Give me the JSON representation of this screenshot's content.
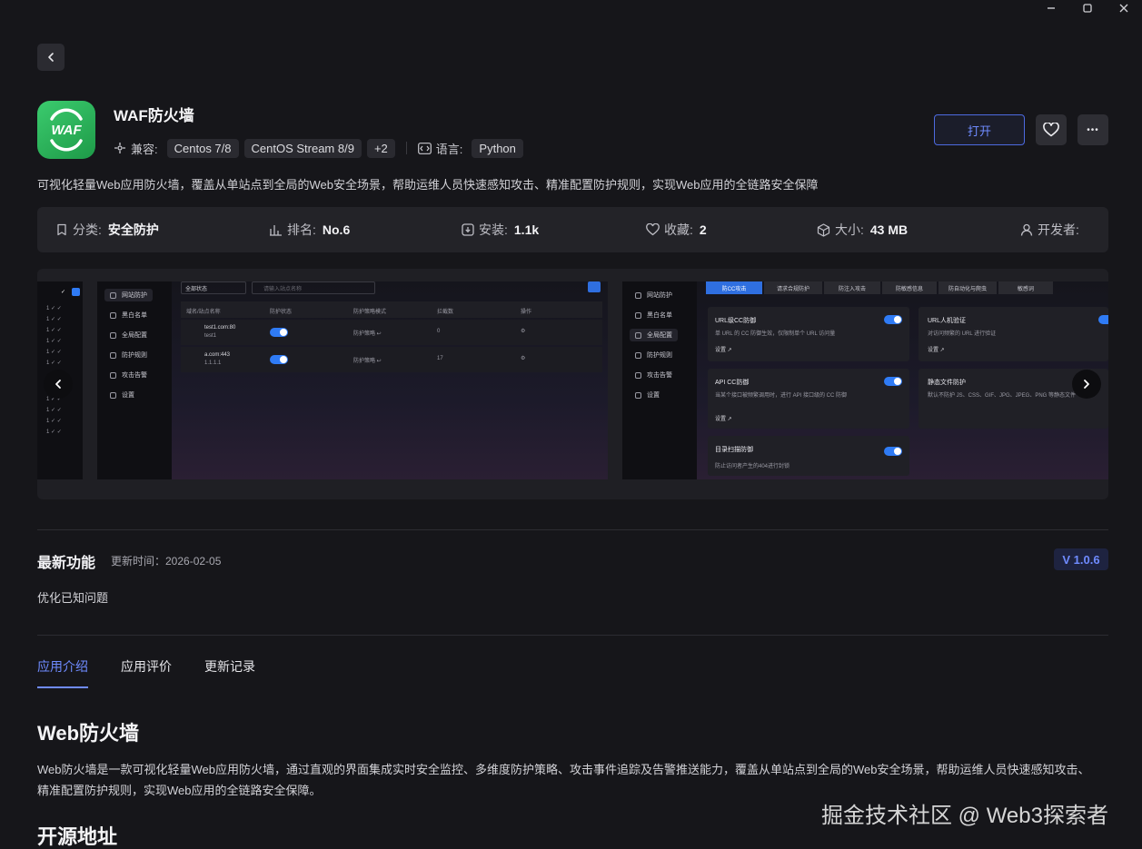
{
  "window": {
    "minimize": "—",
    "maximize": "☐",
    "close": "✕"
  },
  "app": {
    "icon_text": "WAF",
    "title": "WAF防火墙",
    "compat_label": "兼容:",
    "compat": [
      "Centos 7/8",
      "CentOS Stream 8/9",
      "+2"
    ],
    "lang_label": "语言:",
    "lang": "Python",
    "description": "可视化轻量Web应用防火墙，覆盖从单站点到全局的Web安全场景，帮助运维人员快速感知攻击、精准配置防护规则，实现Web应用的全链路安全保障"
  },
  "actions": {
    "open": "打开",
    "favorite_icon": "heart-icon",
    "more": "•••"
  },
  "stats": {
    "category_label": "分类:",
    "category": "安全防护",
    "rank_label": "排名:",
    "rank": "No.6",
    "install_label": "安装:",
    "install": "1.1k",
    "fav_label": "收藏:",
    "fav": "2",
    "size_label": "大小:",
    "size": "43 MB",
    "dev_label": "开发者:"
  },
  "screenshots": {
    "left": {
      "menu": [
        "网站防护",
        "黑白名单",
        "全局配置",
        "防护规则",
        "攻击告警",
        "设置"
      ],
      "filter": "全部状态",
      "search_placeholder": "请输入站点名称",
      "headers": [
        "域名/站点名称",
        "防护状态",
        "防护策略模式",
        "拦截数",
        "操作"
      ],
      "rows": [
        {
          "domain": "test1.com:80",
          "sub": "test1",
          "mode": "防护策略 ↩",
          "count": "0"
        },
        {
          "domain": "a.com:443",
          "sub": "1.1.1.1",
          "mode": "防护策略 ↩",
          "count": "17"
        }
      ]
    },
    "right": {
      "menu": [
        "网站防护",
        "黑白名单",
        "全局配置",
        "防护规则",
        "攻击告警",
        "设置"
      ],
      "tabs": [
        "防CC攻击",
        "请求合规防护",
        "防注入攻击",
        "防敏感信息",
        "防自动化与爬虫",
        "敏感词"
      ],
      "cards": [
        {
          "title": "URL级CC防御",
          "desc": "单 URL 的 CC 防御生效，仅限制单个 URL 访问量",
          "link": "设置 ↗"
        },
        {
          "title": "URL人机验证",
          "desc": "对访问频繁的 URL 进行验证",
          "link": "设置 ↗"
        },
        {
          "title": "API CC防御",
          "desc": "当某个接口被频繁调用时，进行 API 接口级的 CC 防御",
          "link": "设置 ↗"
        },
        {
          "title": "静态文件防护",
          "desc": "默认不防护 JS、CSS、GIF、JPG、JPEG、PNG 等静态文件",
          "link": ""
        },
        {
          "title": "目录扫描防御",
          "desc": "防止访问者产生的404进行封锁",
          "link": ""
        }
      ]
    }
  },
  "release": {
    "title": "最新功能",
    "time": "更新时间：2026-02-05",
    "version": "V 1.0.6",
    "body": "优化已知问题"
  },
  "tabs": [
    "应用介绍",
    "应用评价",
    "更新记录"
  ],
  "intro": {
    "heading": "Web防火墙",
    "paragraph": "Web防火墙是一款可视化轻量Web应用防火墙，通过直观的界面集成实时安全监控、多维度防护策略、攻击事件追踪及告警推送能力，覆盖从单站点到全局的Web安全场景，帮助运维人员快速感知攻击、精准配置防护规则，实现Web应用的全链路安全保障。",
    "heading2": "开源地址"
  },
  "watermark": "掘金技术社区 @ Web3探索者"
}
